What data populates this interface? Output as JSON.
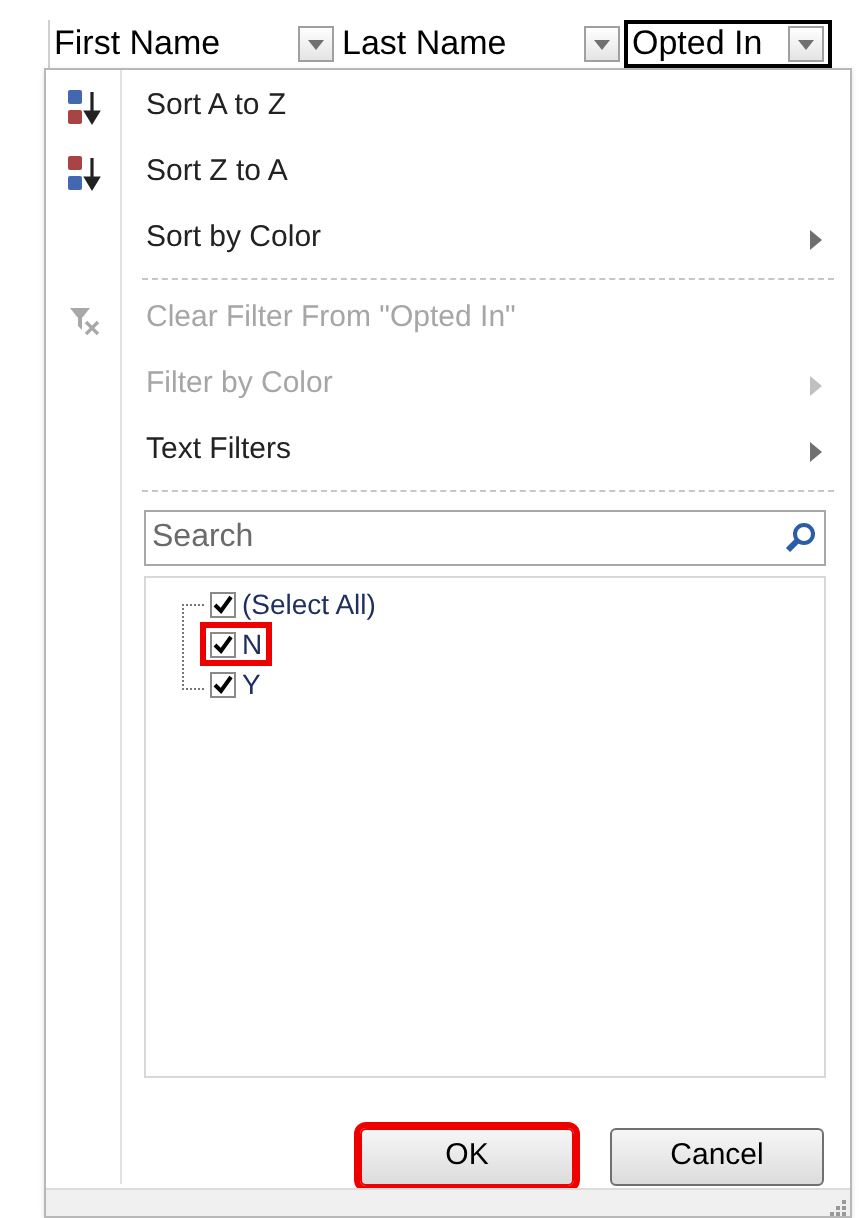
{
  "columns": [
    {
      "label": "First Name",
      "selected": false
    },
    {
      "label": "Last Name",
      "selected": false
    },
    {
      "label": "Opted In",
      "selected": true
    }
  ],
  "menu": [
    {
      "kind": "item",
      "label": "Sort A to Z",
      "disabled": false,
      "submenu": false
    },
    {
      "kind": "item",
      "label": "Sort Z to A",
      "disabled": false,
      "submenu": false
    },
    {
      "kind": "item",
      "label": "Sort by Color",
      "disabled": false,
      "submenu": true
    },
    {
      "kind": "separator"
    },
    {
      "kind": "item",
      "label": "Clear Filter From \"Opted In\"",
      "disabled": true,
      "submenu": false
    },
    {
      "kind": "item",
      "label": "Filter by Color",
      "disabled": true,
      "submenu": true
    },
    {
      "kind": "item",
      "label": "Text Filters",
      "disabled": false,
      "submenu": true
    },
    {
      "kind": "separator"
    }
  ],
  "search": {
    "placeholder": "Search"
  },
  "values": [
    {
      "label": "(Select All)",
      "checked": true,
      "highlighted": false,
      "children": [
        {
          "label": "N",
          "checked": true,
          "highlighted": true
        },
        {
          "label": "Y",
          "checked": true,
          "highlighted": false
        }
      ]
    }
  ],
  "buttons": [
    {
      "label": "OK",
      "highlighted": true
    },
    {
      "label": "Cancel",
      "highlighted": false
    }
  ]
}
